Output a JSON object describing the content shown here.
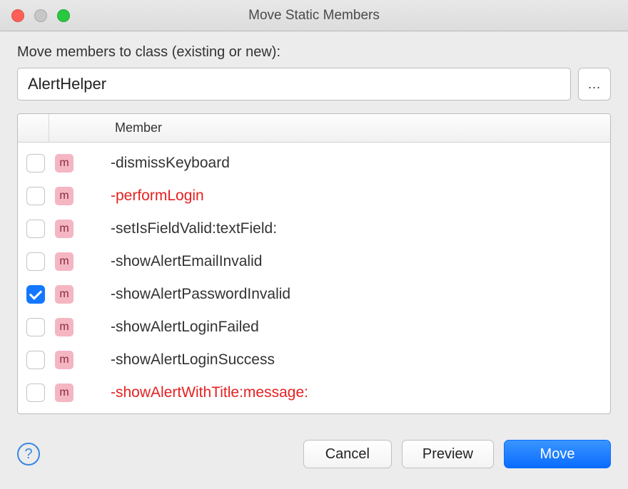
{
  "window": {
    "title": "Move Static Members"
  },
  "prompt": {
    "label": "Move members to class (existing or new):"
  },
  "input": {
    "class_name": "AlertHelper",
    "browse_label": "..."
  },
  "table": {
    "header": "Member",
    "badge_letter": "m",
    "rows": [
      {
        "checked": false,
        "name": "-dismissKeyboard",
        "highlighted": false
      },
      {
        "checked": false,
        "name": "-performLogin",
        "highlighted": true
      },
      {
        "checked": false,
        "name": "-setIsFieldValid:textField:",
        "highlighted": false
      },
      {
        "checked": false,
        "name": "-showAlertEmailInvalid",
        "highlighted": false
      },
      {
        "checked": true,
        "name": "-showAlertPasswordInvalid",
        "highlighted": false
      },
      {
        "checked": false,
        "name": "-showAlertLoginFailed",
        "highlighted": false
      },
      {
        "checked": false,
        "name": "-showAlertLoginSuccess",
        "highlighted": false
      },
      {
        "checked": false,
        "name": "-showAlertWithTitle:message:",
        "highlighted": true
      }
    ]
  },
  "footer": {
    "help_label": "?",
    "cancel": "Cancel",
    "preview": "Preview",
    "move": "Move"
  }
}
